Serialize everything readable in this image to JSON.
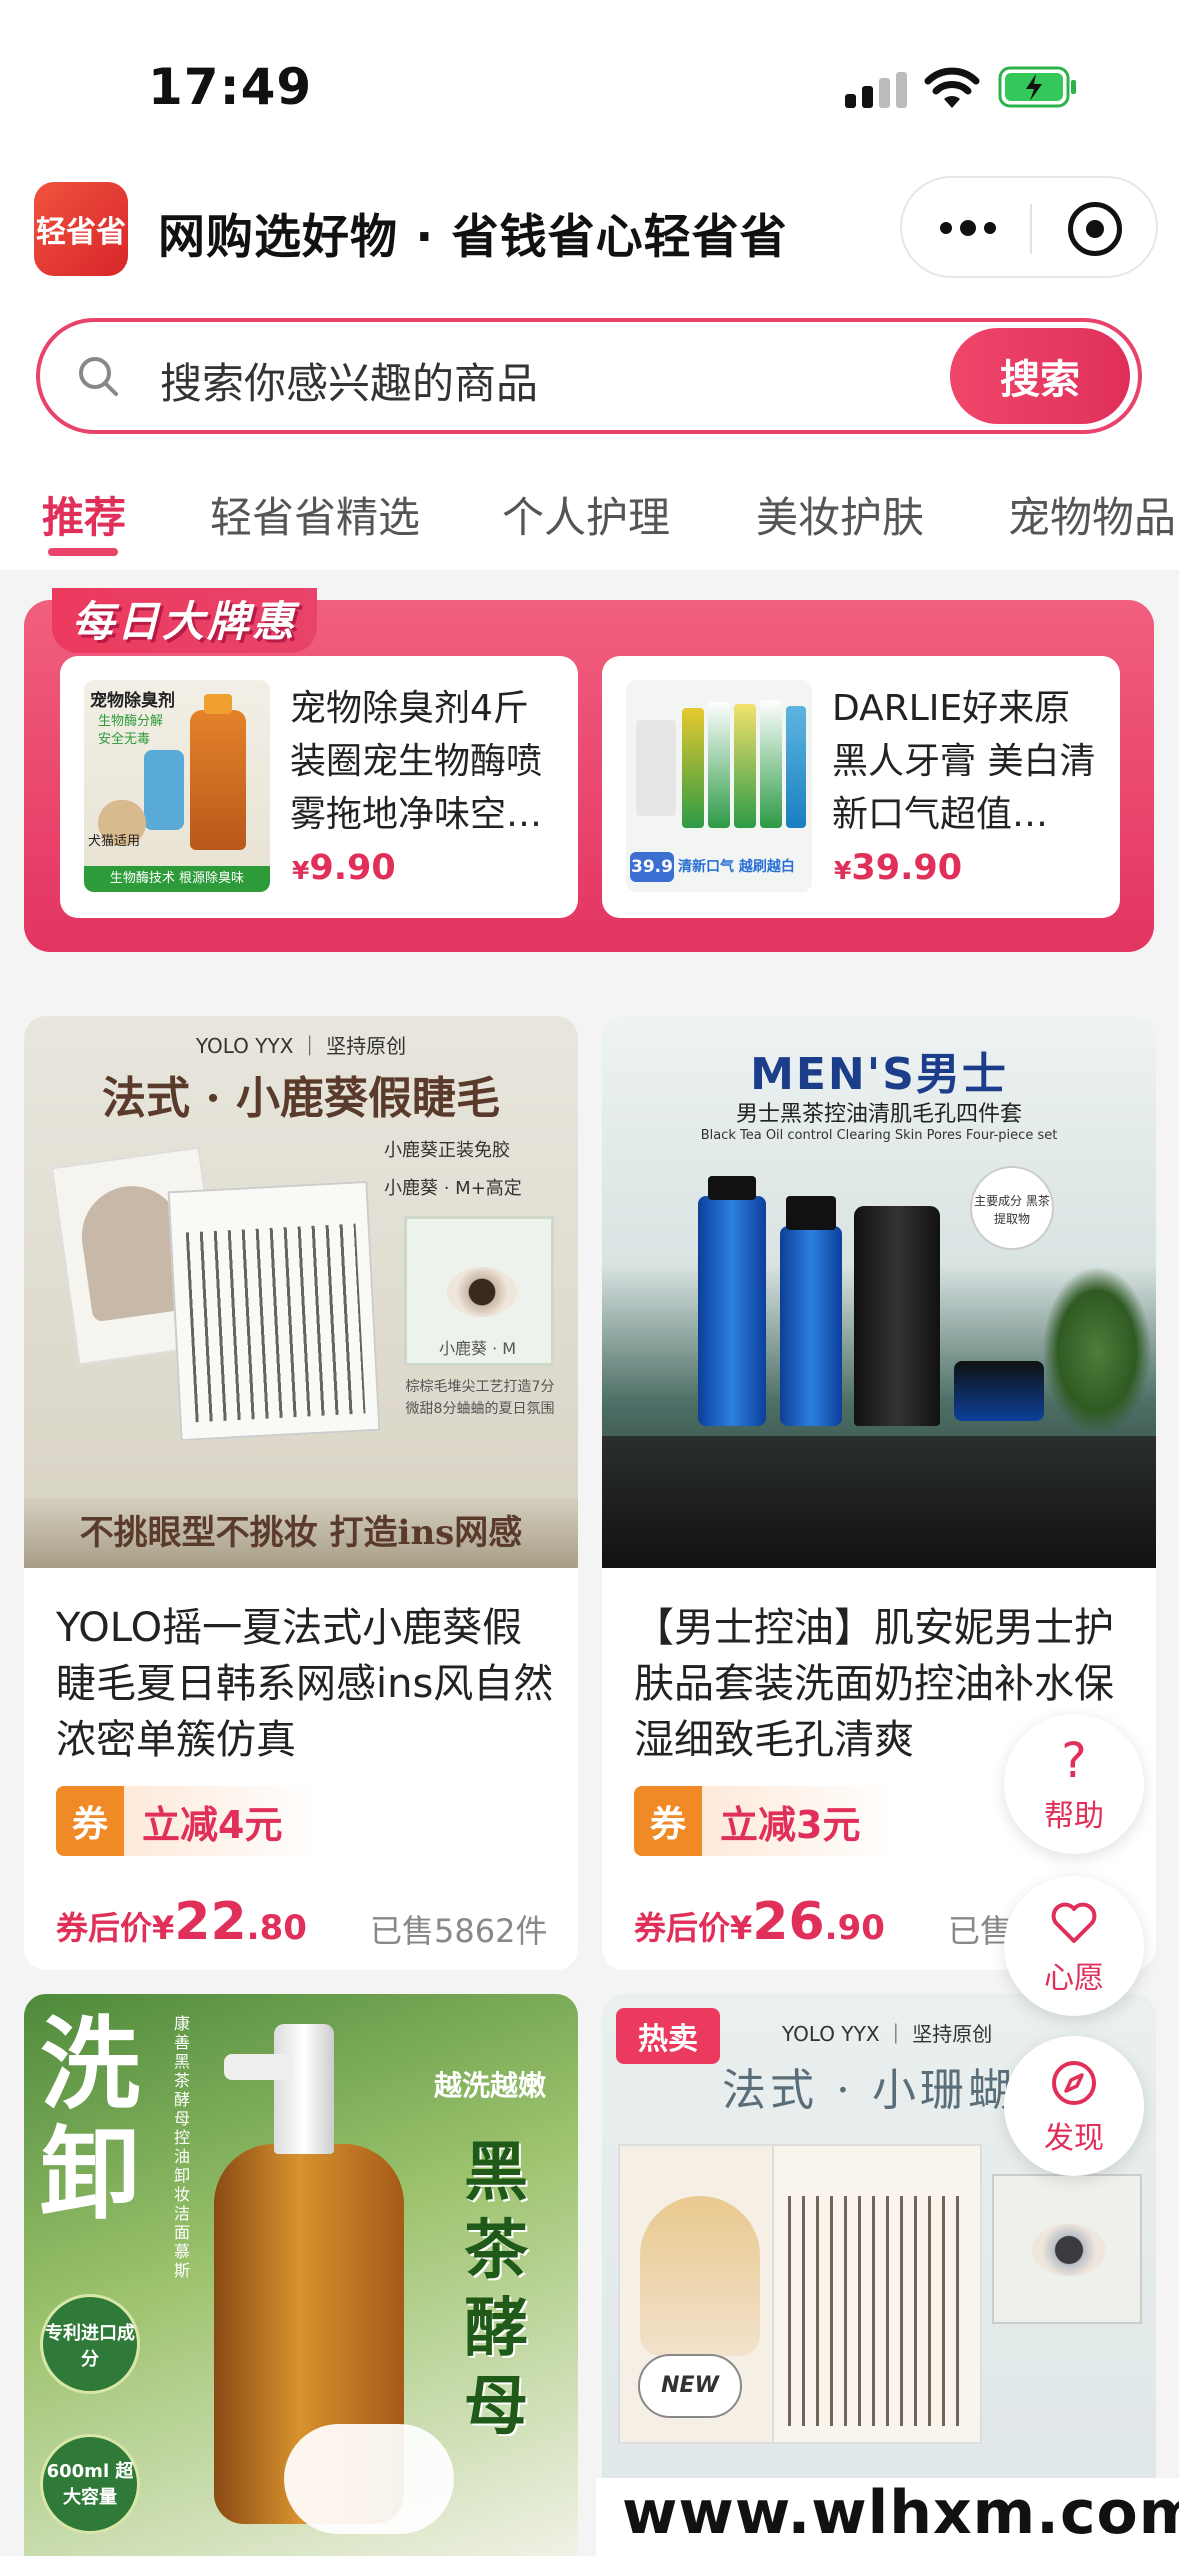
{
  "status_bar": {
    "time": "17:49"
  },
  "header": {
    "logo_text": "轻省省",
    "title": "网购选好物 · 省钱省心轻省省"
  },
  "search": {
    "placeholder": "搜索你感兴趣的商品",
    "button": "搜索"
  },
  "tabs": [
    {
      "label": "推荐",
      "active": true
    },
    {
      "label": "轻省省精选"
    },
    {
      "label": "个人护理"
    },
    {
      "label": "美妆护肤"
    },
    {
      "label": "宠物物品"
    }
  ],
  "daily_deals": {
    "title": "每日大牌惠",
    "items": [
      {
        "name": "宠物除臭剂4斤装圈宠生物酶喷雾拖地净味空…",
        "currency": "¥",
        "price": "9.90",
        "img_text": [
          "宠物除臭剂",
          "生物酶分解",
          "安全无毒",
          "犬猫适用",
          "生物酶技术 根源除臭味"
        ]
      },
      {
        "name": "DARLIE好来原黑人牙膏 美白清新口气超值…",
        "currency": "¥",
        "price": "39.90",
        "img_text": [
          "39.9",
          "清新口气 越刷越白"
        ]
      }
    ]
  },
  "products": [
    {
      "name": "YOLO摇一夏法式小鹿葵假睫毛夏日韩系网感ins风自然浓密单簇仿真",
      "coupon_tag": "券",
      "coupon": "立减4元",
      "price_label": "券后价¥",
      "price_int": "22",
      "price_dec": ".80",
      "sold": "已售5862件",
      "img_text": {
        "brand": "YOLO YYX ｜ 坚持原创",
        "headline": "法式 · 小鹿葵假睫毛",
        "side": [
          "小鹿葵正装免胶",
          "小鹿葵 · M+高定"
        ],
        "chip": "小鹿葵 · M",
        "desc": "棕棕毛堆尖工艺打造7分微甜8分蛐蛐的夏日氛围",
        "footer": "不挑眼型不挑妆 打造ins网感"
      }
    },
    {
      "name": "【男士控油】肌安妮男士护肤品套装洗面奶控油补水保湿细致毛孔清爽",
      "coupon_tag": "券",
      "coupon": "立减3元",
      "price_label": "券后价¥",
      "price_int": "26",
      "price_dec": ".90",
      "sold": "已售",
      "img_text": {
        "brand": "MEN'S男士",
        "subtitle": "男士黑茶控油清肌毛孔四件套",
        "english": "Black Tea Oil control Clearing Skin Pores Four-piece set",
        "badge": "主要成分 黑茶提取物"
      }
    },
    {
      "name": "",
      "img_text": {
        "big": "洗卸",
        "right": "黑茶酵母",
        "tag": "越洗越嫩",
        "patent": "专利进口成分",
        "capacity": "600ml 超大容量",
        "vertical": "康善黑茶酵母控油卸妆洁面慕斯"
      }
    },
    {
      "name": "",
      "hot": "热卖",
      "img_text": {
        "brand": "YOLO YYX ｜ 坚持原创",
        "headline": "法式 · 小珊蝴",
        "new": "NEW"
      }
    }
  ],
  "floating": [
    {
      "label": "帮助",
      "icon": "question-icon"
    },
    {
      "label": "心愿",
      "icon": "heart-icon"
    },
    {
      "label": "发现",
      "icon": "compass-icon"
    }
  ],
  "watermark": "www.wlhxm.com",
  "colors": {
    "accent": "#e0305a",
    "coupon": "#f08a26"
  }
}
